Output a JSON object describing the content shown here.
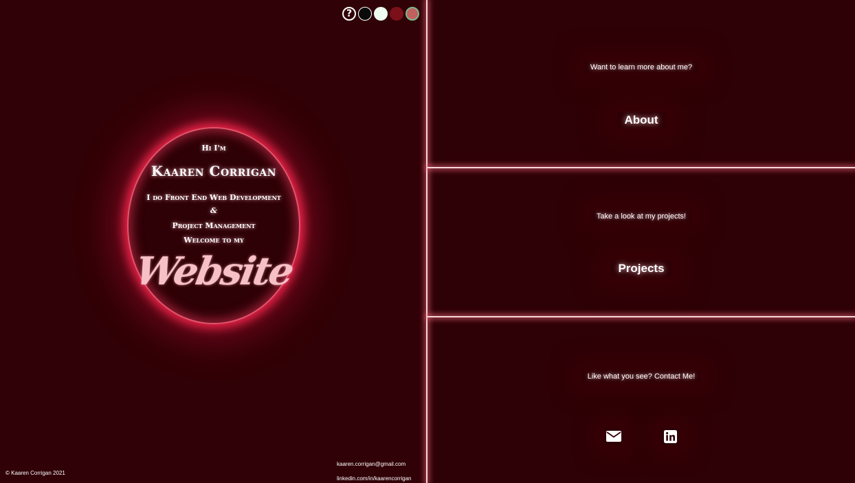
{
  "theme": {
    "help_label": "?",
    "swatches": [
      {
        "name": "black",
        "color": "#0a0a0a"
      },
      {
        "name": "mint",
        "color": "#f0fbf0"
      },
      {
        "name": "dark-red",
        "color": "#7b1019"
      },
      {
        "name": "rose-green",
        "color": "#c0615f"
      }
    ]
  },
  "hero": {
    "greeting": "Hi I'm",
    "name": "Kaaren Corrigan",
    "role1": "I do Front End Web Development",
    "ampersand": "&",
    "role2": "Project Management",
    "welcome": "Welcome to my",
    "website": "Website"
  },
  "footer": {
    "copyright": "© Kaaren Corrigan 2021",
    "email": "kaaren.corrigan@gmail.com",
    "linkedin": "linkedin.com/in/kaarencorrigan"
  },
  "sections": {
    "about": {
      "prompt": "Want to learn more about me?",
      "link": "About"
    },
    "projects": {
      "prompt": "Take a look at my projects!",
      "link": "Projects"
    },
    "contact": {
      "prompt": "Like what you see? Contact Me!"
    }
  },
  "colors": {
    "background": "#300106",
    "glow": "#ff2850",
    "accent_text": "#f7c0c6"
  },
  "icons": [
    "question-icon",
    "envelope-icon",
    "linkedin-icon"
  ]
}
